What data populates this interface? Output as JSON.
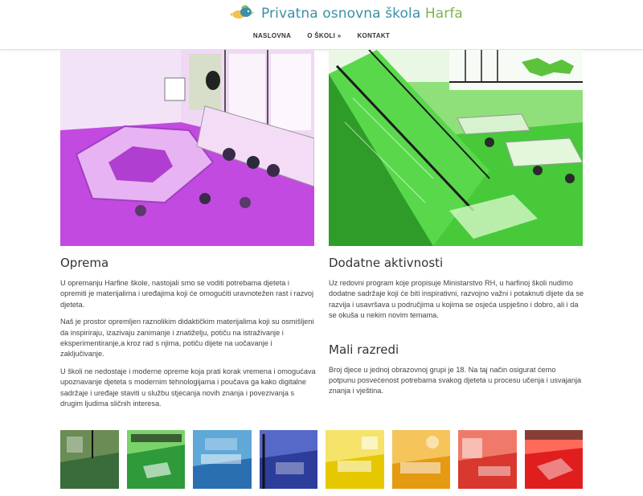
{
  "brand": {
    "title_main": "Privatna osnovna škola ",
    "title_accent": "Harfa",
    "logo_icon": "bird-fish-logo-icon"
  },
  "nav": {
    "items": [
      {
        "label": "NASLOVNA"
      },
      {
        "label": "O ŠKOLI »"
      },
      {
        "label": "KONTAKT"
      }
    ]
  },
  "left": {
    "heading": "Oprema",
    "paragraphs": [
      "U opremanju Harfine škole, nastojali smo se voditi potrebama djeteta i opremiti je materijalima i uređajima koji će omogućiti uravnotežen rast i razvoj djeteta.",
      "Naš je prostor opremljen raznolikim didaktičkim materijalima koji su osmišljeni da inspiriraju, izazivaju zanimanje i znatiželju, potiču na istraživanje i eksperimentiranje,a kroz rad s njima, potiču dijete na uočavanje i zaključivanje.",
      "U školi ne nedostaje i moderne opreme koja prati korak vremena i omogućava upoznavanje djeteta s modernim tehnologijama i poučava ga kako digitalne sadržaje i uređaje staviti u službu stjecanja novih znanja i povezivanja s drugim ljudima sličnih interesa."
    ]
  },
  "right": {
    "heading_1": "Dodatne aktivnosti",
    "paragraph_1": "Uz redovni program koje propisuje Ministarstvo RH, u harfinoj školi nudimo dodatne sadržaje koji će biti inspirativni, razvojno važni i potaknuti dijete da se razvija i usavršava u područjima u kojima se osjeća uspješno i dobro, ali i da se okuša u nekim novim temama.",
    "heading_2": "Mali razredi",
    "paragraph_2": "Broj djece u jednoj obrazovnoj grupi je 18. Na taj način osigurat ćemo potpunu posvećenost potrebama svakog djeteta u procesu učenja i usvajanja znanja i vještina."
  },
  "colors": {
    "brand_blue": "#3b8fa8",
    "brand_green": "#7ab648",
    "hero_left_tint": "#c832e0",
    "hero_right_tint": "#3fc83a"
  },
  "thumbnails": [
    {
      "tint": "#3a6b3a",
      "accent": "#6a8c55"
    },
    {
      "tint": "#2e9a3a",
      "accent": "#7ad36a"
    },
    {
      "tint": "#2a6fb0",
      "accent": "#5fa8d8"
    },
    {
      "tint": "#2c3d9a",
      "accent": "#5669c8"
    },
    {
      "tint": "#e6c800",
      "accent": "#f5e36a"
    },
    {
      "tint": "#e59a12",
      "accent": "#f5c45a"
    },
    {
      "tint": "#d8382e",
      "accent": "#f07a6a"
    },
    {
      "tint": "#e01e1e",
      "accent": "#ff6a5a"
    }
  ]
}
